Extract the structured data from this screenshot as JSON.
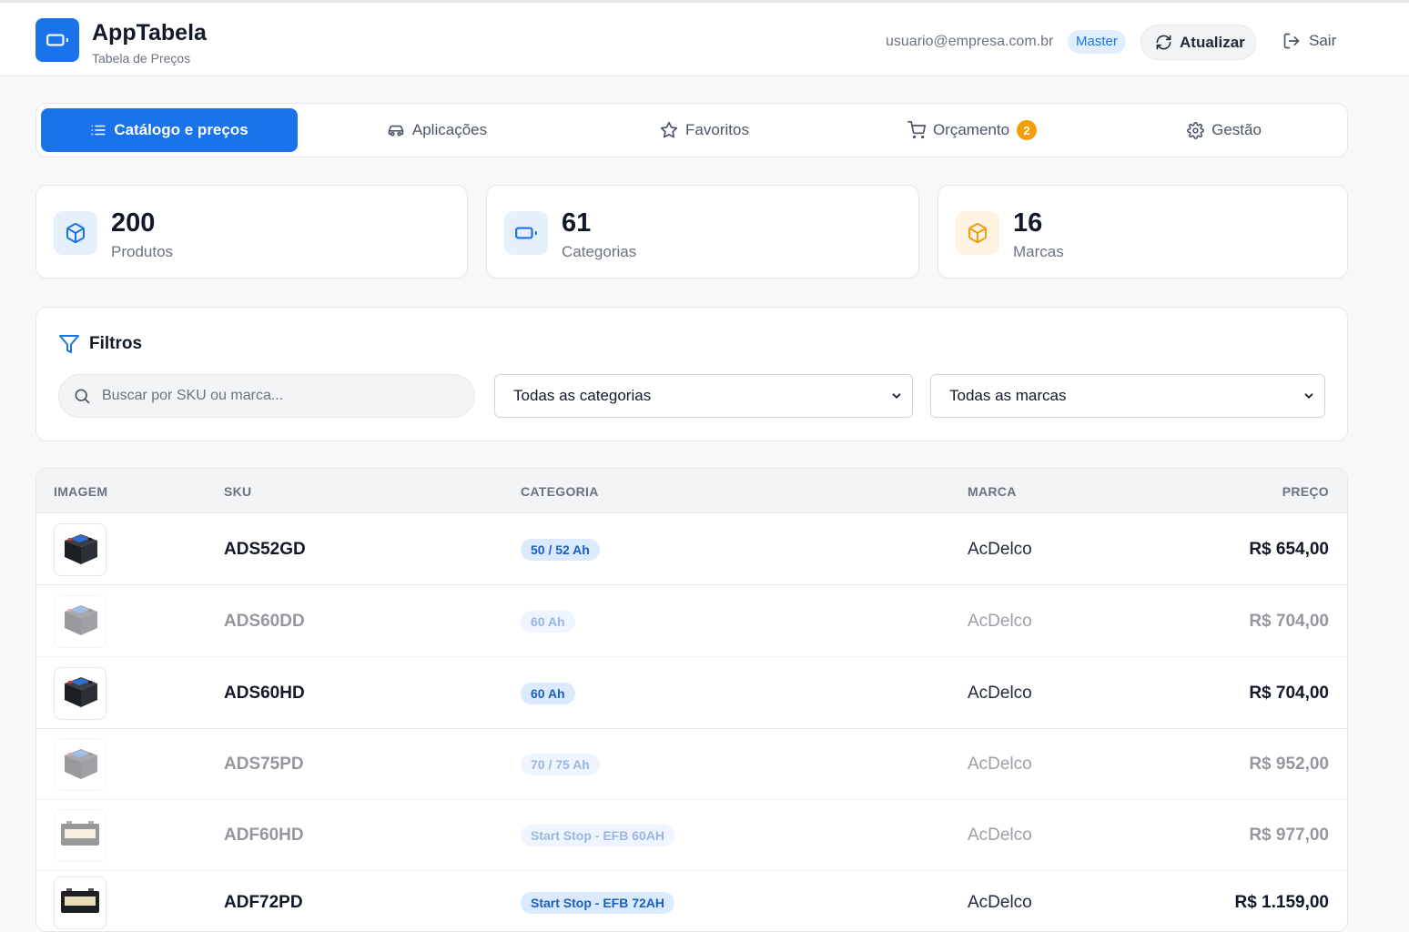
{
  "header": {
    "title": "AppTabela",
    "subtitle": "Tabela de Preços",
    "user_email": "usuario@empresa.com.br",
    "role": "Master",
    "refresh_label": "Atualizar",
    "logout_label": "Sair"
  },
  "tabs": [
    {
      "label": "Catálogo e preços",
      "icon": "list-icon",
      "active": true
    },
    {
      "label": "Aplicações",
      "icon": "car-icon"
    },
    {
      "label": "Favoritos",
      "icon": "star-icon"
    },
    {
      "label": "Orçamento",
      "icon": "cart-icon",
      "count": "2"
    },
    {
      "label": "Gestão",
      "icon": "gear-icon"
    }
  ],
  "stats": [
    {
      "value": "200",
      "label": "Produtos",
      "icon": "box-icon"
    },
    {
      "value": "61",
      "label": "Categorias",
      "icon": "battery-icon"
    },
    {
      "value": "16",
      "label": "Marcas",
      "icon": "box-icon"
    }
  ],
  "filters": {
    "title": "Filtros",
    "search_placeholder": "Buscar por SKU ou marca...",
    "category_select": "Todas as categorias",
    "brand_select": "Todas as marcas"
  },
  "table": {
    "headers": {
      "image": "IMAGEM",
      "sku": "SKU",
      "category": "CATEGORIA",
      "brand": "MARCA",
      "price": "PREÇO"
    },
    "rows": [
      {
        "sku": "ADS52GD",
        "category": "50 / 52 Ah",
        "brand": "AcDelco",
        "price": "R$ 654,00",
        "image": "battery-dark-icon",
        "dimmed": false
      },
      {
        "sku": "ADS60DD",
        "category": "60 Ah",
        "brand": "AcDelco",
        "price": "R$ 704,00",
        "image": "battery-dark-icon",
        "dimmed": true
      },
      {
        "sku": "ADS60HD",
        "category": "60 Ah",
        "brand": "AcDelco",
        "price": "R$ 704,00",
        "image": "battery-dark-icon",
        "dimmed": false
      },
      {
        "sku": "ADS75PD",
        "category": "70 / 75 Ah",
        "brand": "AcDelco",
        "price": "R$ 952,00",
        "image": "battery-dark-icon",
        "dimmed": true
      },
      {
        "sku": "ADF60HD",
        "category": "Start Stop - EFB 60AH",
        "brand": "AcDelco",
        "price": "R$ 977,00",
        "image": "battery-flat-icon",
        "dimmed": true
      },
      {
        "sku": "ADF72PD",
        "category": "Start Stop - EFB 72AH",
        "brand": "AcDelco",
        "price": "R$ 1.159,00",
        "image": "battery-flat-icon",
        "dimmed": false
      }
    ]
  },
  "colors": {
    "accent": "#1a73e8",
    "badge": "#f59e0b",
    "category_bg": "#dbeafe"
  }
}
